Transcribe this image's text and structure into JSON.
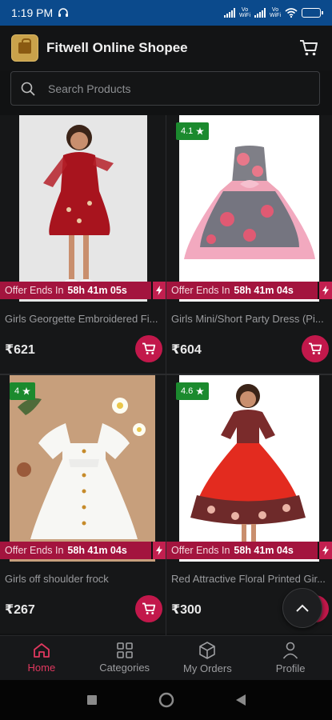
{
  "status_bar": {
    "time": "1:19 PM",
    "battery_level": 0.8
  },
  "header": {
    "title": "Fitwell Online Shopee",
    "cart_icon": "cart-icon",
    "logo": "shop-bag-logo"
  },
  "search": {
    "placeholder": "Search Products"
  },
  "products": [
    {
      "name": "Girls Georgette Embroidered Fi...",
      "price": "₹621",
      "rating": "",
      "offer_prefix": "Offer Ends In",
      "offer_time": "58h 41m 05s"
    },
    {
      "name": "Girls Mini/Short Party Dress (Pi...",
      "price": "₹604",
      "rating": "4.1",
      "offer_prefix": "Offer Ends In",
      "offer_time": "58h 41m 04s"
    },
    {
      "name": "Girls off shoulder frock",
      "price": "₹267",
      "rating": "4",
      "offer_prefix": "Offer Ends In",
      "offer_time": "58h 41m 04s"
    },
    {
      "name": "Red Attractive Floral Printed Gir...",
      "price": "₹300",
      "rating": "4.6",
      "offer_prefix": "Offer Ends In",
      "offer_time": "58h 41m 04s"
    }
  ],
  "bottom_nav": [
    {
      "label": "Home",
      "icon": "home-icon",
      "active": true
    },
    {
      "label": "Categories",
      "icon": "grid-icon",
      "active": false
    },
    {
      "label": "My Orders",
      "icon": "box-icon",
      "active": false
    },
    {
      "label": "Profile",
      "icon": "person-icon",
      "active": false
    }
  ],
  "colors": {
    "accent": "#c2184b",
    "active_nav": "#e0385f",
    "offer_bar": "#a3143e",
    "rating_badge": "#1b8a2e",
    "status_bar": "#0b4a8c"
  }
}
